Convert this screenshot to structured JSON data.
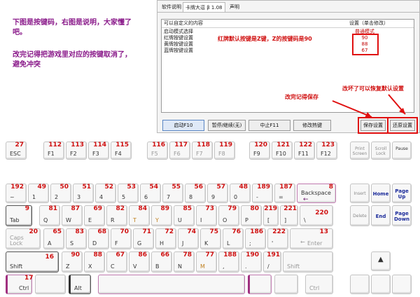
{
  "notes": {
    "line1": "下图是按键码，右图是说明，大家懂了吧。",
    "line2": "改完记得把游戏里对应的按键取消了，避免冲突"
  },
  "app": {
    "tabs": [
      {
        "label": "软件说明"
      },
      {
        "label": "卡牌大逗 β 1.08"
      },
      {
        "label": "声明"
      }
    ],
    "list_header": {
      "col1": "可以自定义的内容",
      "col2": "设置（单击修改）"
    },
    "rows": [
      {
        "name": "启动模式选择",
        "value": "普通模式"
      },
      {
        "name": "红牌按键设置",
        "value": "90"
      },
      {
        "name": "黄牌按键设置",
        "value": "88"
      },
      {
        "name": "蓝牌按键设置",
        "value": "67"
      }
    ],
    "buttons": {
      "start": "启动F10",
      "pause": "暂停/继续(无)",
      "stop": "中止F11",
      "hotkey": "修改热键",
      "save": "保存设置",
      "restore": "还原设置"
    },
    "callouts": {
      "red_key": "红牌默认按键是Z键，Z的按键码是90",
      "save_hint": "改完记得保存",
      "restore_hint": "改坏了可以恢复默认设置"
    }
  },
  "keyboard": {
    "row_f": [
      {
        "label": "ESC",
        "code": "27"
      },
      {
        "label": "F1",
        "code": "112"
      },
      {
        "label": "F2",
        "code": "113"
      },
      {
        "label": "F3",
        "code": "114"
      },
      {
        "label": "F4",
        "code": "115"
      },
      {
        "label": "F5",
        "code": "116"
      },
      {
        "label": "F6",
        "code": "117"
      },
      {
        "label": "F7",
        "code": "118"
      },
      {
        "label": "F8",
        "code": "119"
      },
      {
        "label": "F9",
        "code": "120"
      },
      {
        "label": "F10",
        "code": "121"
      },
      {
        "label": "F11",
        "code": "122"
      },
      {
        "label": "F12",
        "code": "123"
      }
    ],
    "nav_top": [
      {
        "label": "Print Screen"
      },
      {
        "label": "Scroll Lock"
      },
      {
        "label": "Pause"
      }
    ],
    "row_num": [
      {
        "label": "~",
        "code": "192"
      },
      {
        "label": "1",
        "code": "49"
      },
      {
        "label": "2",
        "code": "50"
      },
      {
        "label": "3",
        "code": "51"
      },
      {
        "label": "4",
        "code": "52"
      },
      {
        "label": "5",
        "code": "53"
      },
      {
        "label": "6",
        "code": "54"
      },
      {
        "label": "7",
        "code": "55"
      },
      {
        "label": "8",
        "code": "56"
      },
      {
        "label": "9",
        "code": "57"
      },
      {
        "label": "0",
        "code": "48"
      },
      {
        "label": "-",
        "code": "189"
      },
      {
        "label": "=",
        "code": "187"
      },
      {
        "label": "Backspace",
        "code": "8"
      }
    ],
    "row_q": [
      {
        "label": "Tab",
        "code": "9"
      },
      {
        "label": "Q",
        "code": "81"
      },
      {
        "label": "W",
        "code": "87"
      },
      {
        "label": "E",
        "code": "69"
      },
      {
        "label": "R",
        "code": "82"
      },
      {
        "label": "T",
        "code": "84"
      },
      {
        "label": "Y",
        "code": "89"
      },
      {
        "label": "U",
        "code": "85"
      },
      {
        "label": "I",
        "code": "73"
      },
      {
        "label": "O",
        "code": "79"
      },
      {
        "label": "P",
        "code": "80"
      },
      {
        "label": "[",
        "code": "219"
      },
      {
        "label": "]",
        "code": "221"
      },
      {
        "label": "\\",
        "code": "220"
      }
    ],
    "row_a": [
      {
        "label": "Caps Lock",
        "code": "20"
      },
      {
        "label": "A",
        "code": "65"
      },
      {
        "label": "S",
        "code": "83"
      },
      {
        "label": "D",
        "code": "68"
      },
      {
        "label": "F",
        "code": "70"
      },
      {
        "label": "G",
        "code": "71"
      },
      {
        "label": "H",
        "code": "72"
      },
      {
        "label": "J",
        "code": "74"
      },
      {
        "label": "K",
        "code": "75"
      },
      {
        "label": "L",
        "code": "76"
      },
      {
        "label": ";",
        "code": "186"
      },
      {
        "label": "'",
        "code": "222"
      },
      {
        "label": "Enter",
        "code": "13"
      }
    ],
    "row_z": [
      {
        "label": "Shift",
        "code": "16"
      },
      {
        "label": "Z",
        "code": "90"
      },
      {
        "label": "X",
        "code": "88"
      },
      {
        "label": "C",
        "code": "67"
      },
      {
        "label": "V",
        "code": "86"
      },
      {
        "label": "B",
        "code": "66"
      },
      {
        "label": "N",
        "code": "78"
      },
      {
        "label": "M",
        "code": "77"
      },
      {
        "label": ",",
        "code": "188"
      },
      {
        "label": ".",
        "code": "190"
      },
      {
        "label": "/",
        "code": "191"
      },
      {
        "label": "Shift",
        "code": ""
      }
    ],
    "row_bottom": [
      {
        "label": "Ctrl",
        "code": "17"
      },
      {
        "label": "Alt",
        "code": ""
      },
      {
        "label": "",
        "code": ""
      },
      {
        "label": "Ctrl",
        "code": ""
      }
    ],
    "nav": [
      {
        "label": "Insert"
      },
      {
        "label": "Home"
      },
      {
        "label": "Page Up"
      },
      {
        "label": "Delete"
      },
      {
        "label": "End"
      },
      {
        "label": "Page Down"
      }
    ]
  },
  "colors": {
    "code_red": "#d01010",
    "note_purple": "#8a1a8a",
    "callout_red": "#e01010"
  }
}
